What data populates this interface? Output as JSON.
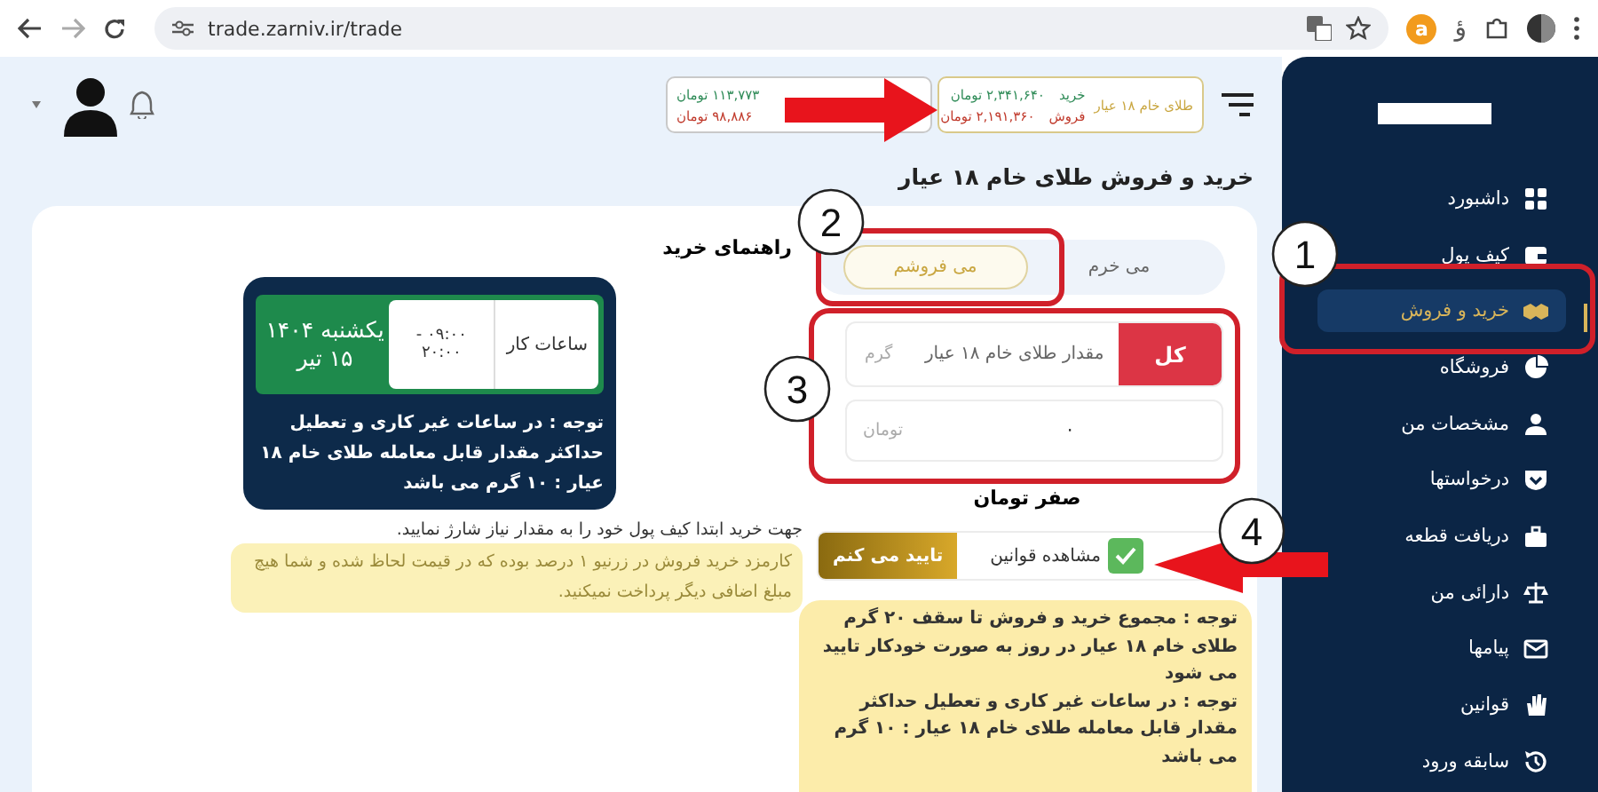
{
  "browser": {
    "url": "trade.zarniv.ir/trade",
    "extension_badge": "a",
    "extension_glyph": "ؤ"
  },
  "price_boxes": [
    {
      "title": "طلای خام ۱۸ عیار",
      "rows": [
        {
          "label": "خرید",
          "value": "۲,۳۴۱,۶۴۰ تومان",
          "kind": "buy"
        },
        {
          "label": "فروش",
          "value": "۲,۱۹۱,۳۶۰ تومان",
          "kind": "sell"
        }
      ]
    },
    {
      "rows": [
        {
          "value": "۱۱۳,۷۷۳ تومان",
          "kind": "buy"
        },
        {
          "value": "۹۸,۸۸۶ تومان",
          "kind": "sell"
        }
      ]
    }
  ],
  "page_title": "خرید و فروش طلای خام ۱۸ عیار",
  "trade_tabs": [
    {
      "label": "می خرم",
      "selected": false
    },
    {
      "label": "می فروشم",
      "selected": true
    }
  ],
  "amount_field": {
    "button": "کل",
    "placeholder": "مقدار طلای خام ۱۸ عیار",
    "unit": "گرم"
  },
  "price_field": {
    "value": "۰",
    "unit": "تومان"
  },
  "total_text": "صفر تومان",
  "terms": {
    "checked": true,
    "link": "مشاهده قوانین",
    "button": "تایید می کنم"
  },
  "limit_notes": [
    "توجه : مجموع خرید و فروش تا سقف ۲۰ گرم طلای خام ۱۸ عیار در روز به صورت خودکار تایید می شود",
    "توجه : در ساعات غیر کاری و تعطیل حداکثر مقدار قابل معامله طلای خام ۱۸ عیار : ۱۰ گرم می باشد"
  ],
  "guide": {
    "title": "راهنمای خرید",
    "hours_label": "ساعات کار",
    "hours": [
      "۰۹:۰۰ -",
      "۲۰:۰۰"
    ],
    "date": [
      "یکشنبه ۱۴۰۴",
      "۱۵ تیر"
    ],
    "notice": "توجه : در ساعات غیر کاری و تعطیل حداکثر مقدار قابل معامله طلای خام ۱۸ عیار : ۱۰ گرم می باشد",
    "wallet_hint": "جهت خرید ابتدا کیف پول خود را به مقدار نیاز شارژ نمایید.",
    "fee_note": "کارمزد خرید فروش در زرنیو ۱ درصد بوده که در قیمت لحاظ شده و شما هیچ مبلغ اضافی دیگر پرداخت نمیکنید."
  },
  "sidebar": {
    "items": [
      {
        "label": "داشبورد",
        "selected": false
      },
      {
        "label": "کیف پول",
        "selected": false
      },
      {
        "label": "خرید و فروش",
        "selected": true
      },
      {
        "label": "فروشگاه",
        "selected": false
      },
      {
        "label": "مشخصات من",
        "selected": false
      },
      {
        "label": "درخواستها",
        "selected": false
      },
      {
        "label": "دریافت قطعه",
        "selected": false
      },
      {
        "label": "دارائی من",
        "selected": false
      },
      {
        "label": "پیامها",
        "selected": false
      },
      {
        "label": "قوانین",
        "selected": false
      },
      {
        "label": "سابقه ورود",
        "selected": false
      }
    ]
  },
  "annotations": [
    {
      "number": "1"
    },
    {
      "number": "2"
    },
    {
      "number": "3"
    },
    {
      "number": "4"
    }
  ]
}
